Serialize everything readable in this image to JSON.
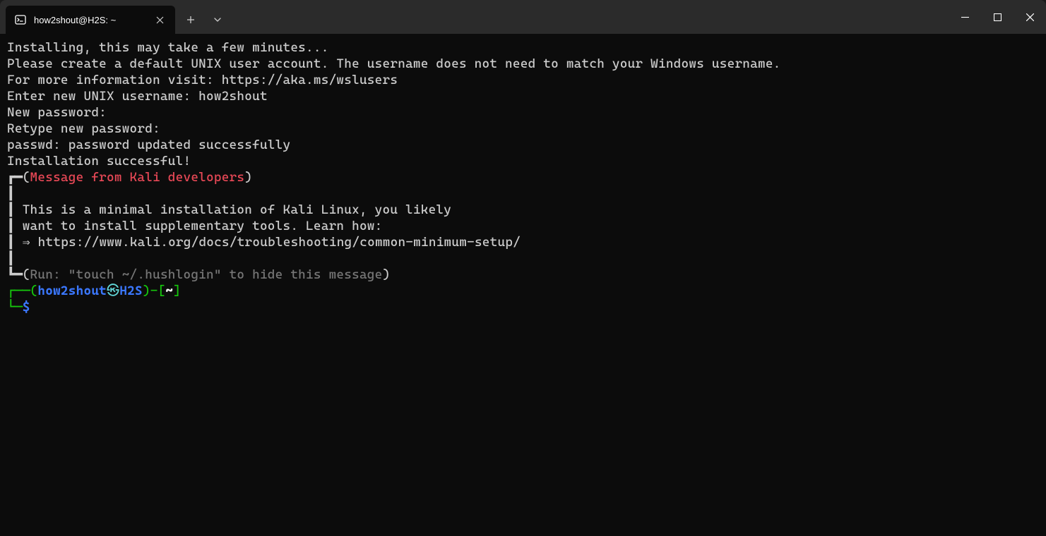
{
  "titlebar": {
    "tab_title": "how2shout@H2S: ~"
  },
  "terminal": {
    "line1": "Installing, this may take a few minutes...",
    "line2": "Please create a default UNIX user account. The username does not need to match your Windows username.",
    "line3": "For more information visit: https://aka.ms/wslusers",
    "line4_prefix": "Enter new UNIX username: ",
    "line4_value": "how2shout",
    "line5": "New password:",
    "line6": "Retype new password:",
    "line7": "passwd: password updated successfully",
    "line8": "Installation successful!",
    "box_top_left": "┏━(",
    "box_header": "Message from Kali developers",
    "box_top_right": ")",
    "box_pipe": "┃",
    "box_msg1": "┃ This is a minimal installation of Kali Linux, you likely",
    "box_msg2": "┃ want to install supplementary tools. Learn how:",
    "box_msg3": "┃ ⇒ https://www.kali.org/docs/troubleshooting/common-minimum-setup/",
    "box_bot_left": "┗━(",
    "box_footer": "Run: \"touch ~/.hushlogin\" to hide this message",
    "box_bot_right": ")",
    "prompt_top_left": "┌──(",
    "prompt_user": "how2shout",
    "prompt_skull": "㉿",
    "prompt_host": "H2S",
    "prompt_paren_dash": ")-[",
    "prompt_path": "~",
    "prompt_close": "]",
    "prompt_bot_left": "└─",
    "prompt_dollar": "$"
  }
}
